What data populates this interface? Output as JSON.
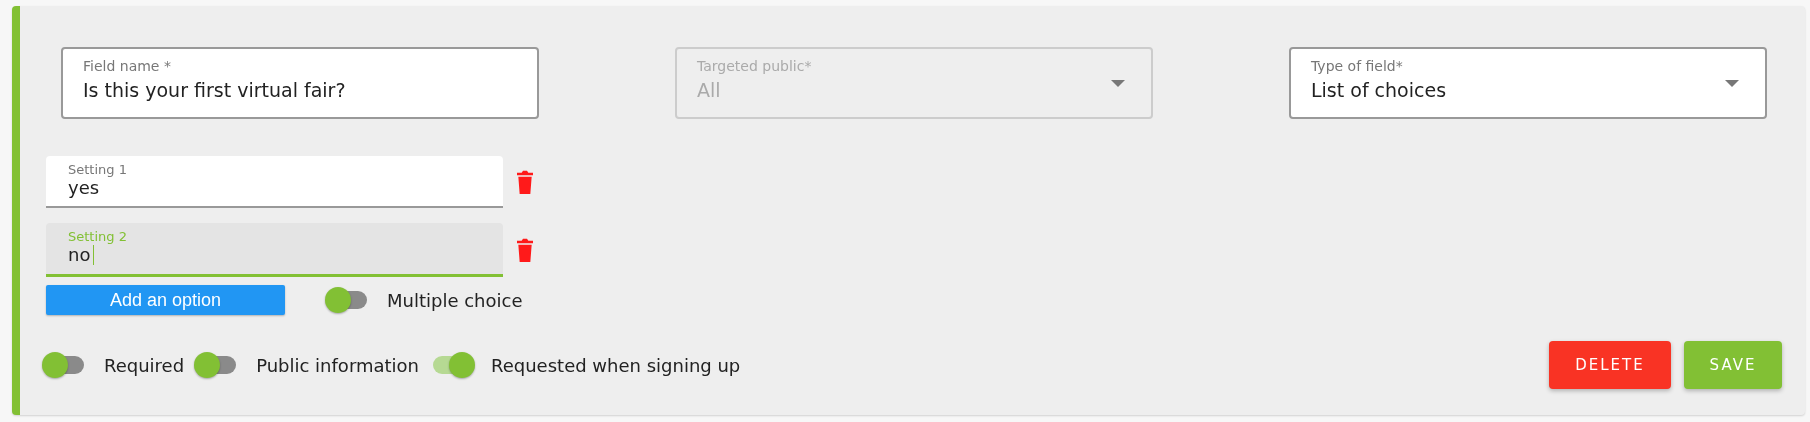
{
  "fields": [
    {
      "kind": "text",
      "label": "Field name *",
      "value": "Is this your first virtual fair?",
      "disabled": false
    },
    {
      "kind": "select",
      "label": "Targeted public*",
      "value": "All",
      "disabled": true
    },
    {
      "kind": "select",
      "label": "Type of field*",
      "value": "List of choices",
      "disabled": false
    }
  ],
  "settings": [
    {
      "label": "Setting 1",
      "value": "yes",
      "focused": false
    },
    {
      "label": "Setting 2",
      "value": "no",
      "focused": true
    }
  ],
  "add_option": "Add an option",
  "multiple_choice": {
    "label": "Multiple choice",
    "on": false
  },
  "toggles": [
    {
      "label": "Required",
      "on": false
    },
    {
      "label": "Public information",
      "on": false
    },
    {
      "label": "Requested when signing up",
      "on": true
    }
  ],
  "buttons": [
    {
      "kind": "delete",
      "label": "DELETE"
    },
    {
      "kind": "save",
      "label": "SAVE"
    }
  ]
}
